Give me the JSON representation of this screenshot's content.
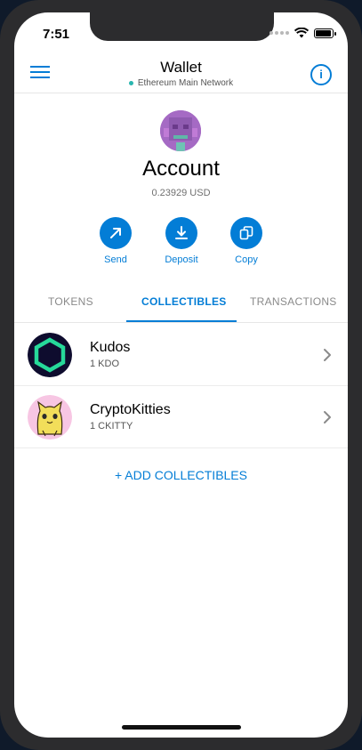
{
  "status_bar": {
    "time": "7:51"
  },
  "header": {
    "title": "Wallet",
    "network": "Ethereum Main Network"
  },
  "account": {
    "name": "Account",
    "balance": "0.23929 USD"
  },
  "actions": [
    {
      "label": "Send",
      "icon": "arrow-up-right-icon"
    },
    {
      "label": "Deposit",
      "icon": "download-icon"
    },
    {
      "label": "Copy",
      "icon": "copy-icon"
    }
  ],
  "tabs": [
    {
      "label": "TOKENS",
      "active": false
    },
    {
      "label": "COLLECTIBLES",
      "active": true
    },
    {
      "label": "TRANSACTIONS",
      "active": false
    }
  ],
  "collectibles": [
    {
      "name": "Kudos",
      "amount": "1 KDO"
    },
    {
      "name": "CryptoKitties",
      "amount": "1 CKITTY"
    }
  ],
  "add_collectibles": "+ ADD COLLECTIBLES",
  "colors": {
    "accent": "#037dd6",
    "network_dot": "#29b6af"
  }
}
